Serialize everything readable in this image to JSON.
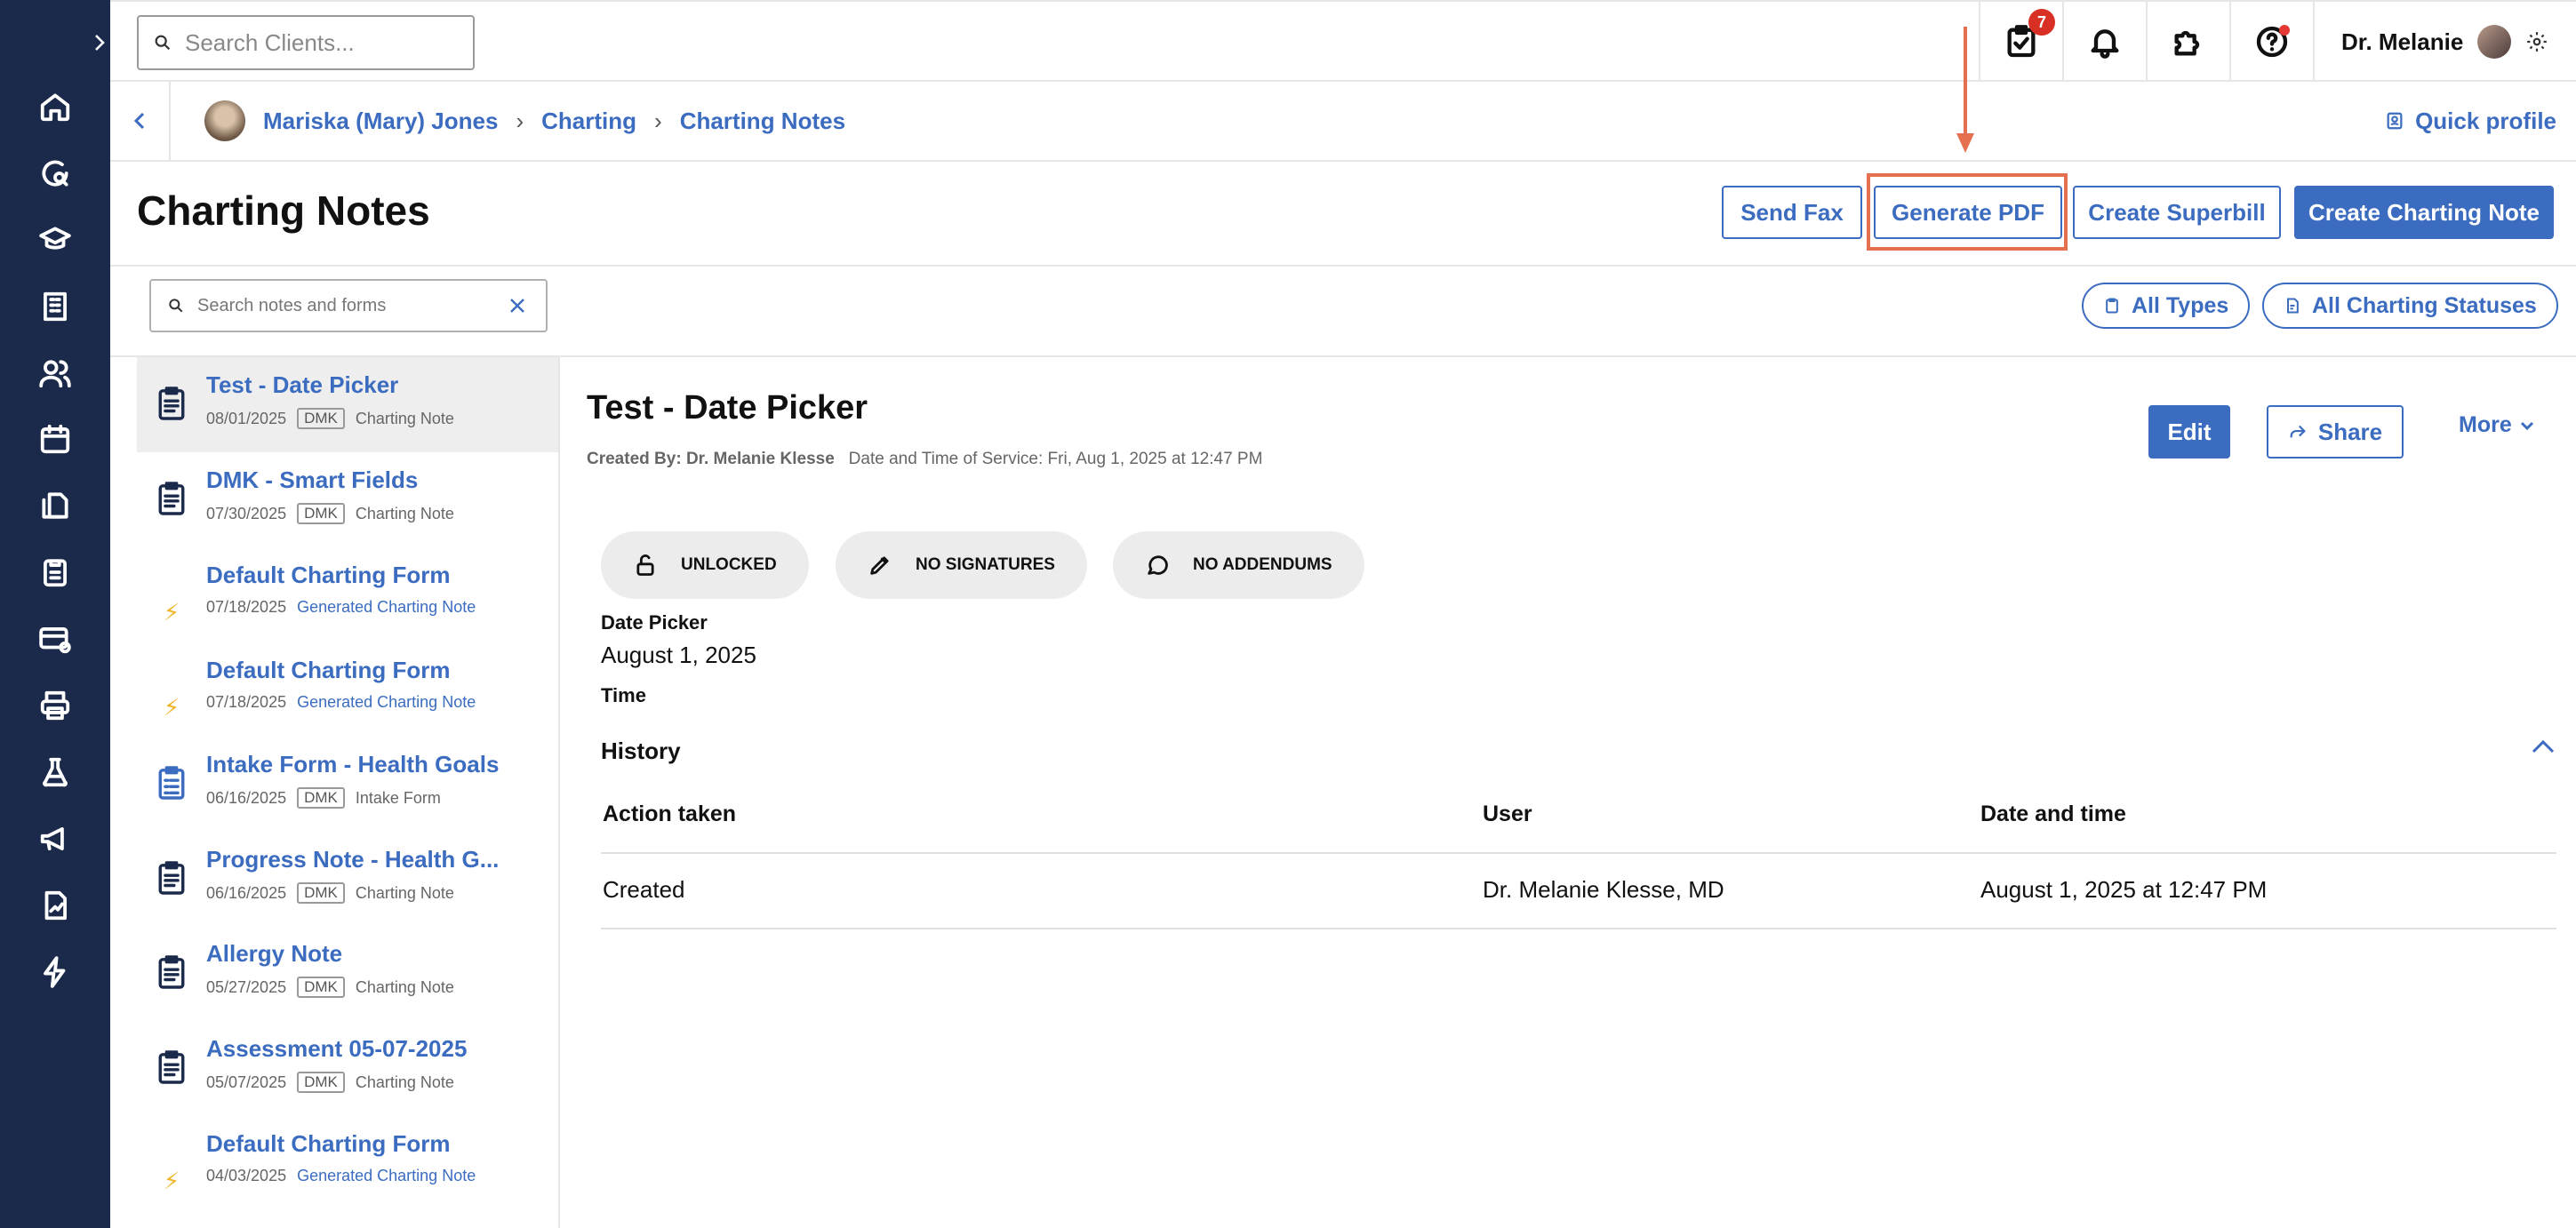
{
  "topbar": {
    "search_placeholder": "Search Clients...",
    "tasks_badge": "7",
    "user_name": "Dr. Melanie"
  },
  "breadcrumb": {
    "client": "Mariska (Mary) Jones",
    "section": "Charting",
    "page": "Charting Notes",
    "quick_profile": "Quick profile"
  },
  "header": {
    "title": "Charting Notes",
    "send_fax": "Send Fax",
    "generate_pdf": "Generate PDF",
    "create_superbill": "Create Superbill",
    "create_note": "Create Charting Note"
  },
  "filters": {
    "search_placeholder": "Search notes and forms",
    "all_types": "All Types",
    "all_statuses": "All Charting Statuses"
  },
  "notes": [
    {
      "title": "Test - Date Picker",
      "date": "08/01/2025",
      "tag": "DMK",
      "type": "Charting Note",
      "icon": "clipboard-note-icon"
    },
    {
      "title": "DMK - Smart Fields",
      "date": "07/30/2025",
      "tag": "DMK",
      "type": "Charting Note",
      "icon": "clipboard-note-icon"
    },
    {
      "title": "Default Charting Form",
      "date": "07/18/2025",
      "tag": "",
      "type": "Generated Charting Note",
      "icon": "lightning-icon"
    },
    {
      "title": "Default Charting Form",
      "date": "07/18/2025",
      "tag": "",
      "type": "Generated Charting Note",
      "icon": "lightning-icon"
    },
    {
      "title": "Intake Form - Health Goals",
      "date": "06/16/2025",
      "tag": "DMK",
      "type": "Intake Form",
      "icon": "intake-form-icon"
    },
    {
      "title": "Progress Note - Health G...",
      "date": "06/16/2025",
      "tag": "DMK",
      "type": "Charting Note",
      "icon": "clipboard-note-icon"
    },
    {
      "title": "Allergy Note",
      "date": "05/27/2025",
      "tag": "DMK",
      "type": "Charting Note",
      "icon": "clipboard-note-icon"
    },
    {
      "title": "Assessment 05-07-2025",
      "date": "05/07/2025",
      "tag": "DMK",
      "type": "Charting Note",
      "icon": "clipboard-note-icon"
    },
    {
      "title": "Default Charting Form",
      "date": "04/03/2025",
      "tag": "",
      "type": "Generated Charting Note",
      "icon": "lightning-icon"
    }
  ],
  "detail": {
    "title": "Test - Date Picker",
    "created_by_label": "Created By:",
    "created_by": "Dr. Melanie Klesse",
    "service_label": "Date and Time of Service:",
    "service": "Fri, Aug 1, 2025 at 12:47 PM",
    "edit": "Edit",
    "share": "Share",
    "more": "More",
    "chip_unlocked": "UNLOCKED",
    "chip_signatures": "NO SIGNATURES",
    "chip_addendums": "NO ADDENDUMS",
    "date_picker_label": "Date Picker",
    "date_picker_value": "August 1, 2025",
    "time_label": "Time",
    "history_title": "History",
    "columns": [
      "Action taken",
      "User",
      "Date and time"
    ],
    "rows": [
      {
        "action": "Created",
        "user": "Dr. Melanie Klesse, MD",
        "datetime": "August 1, 2025 at 12:47 PM"
      }
    ]
  },
  "colors": {
    "accent": "#3b6cc0",
    "rail": "#1b2a4a",
    "highlight": "#e5704f"
  }
}
